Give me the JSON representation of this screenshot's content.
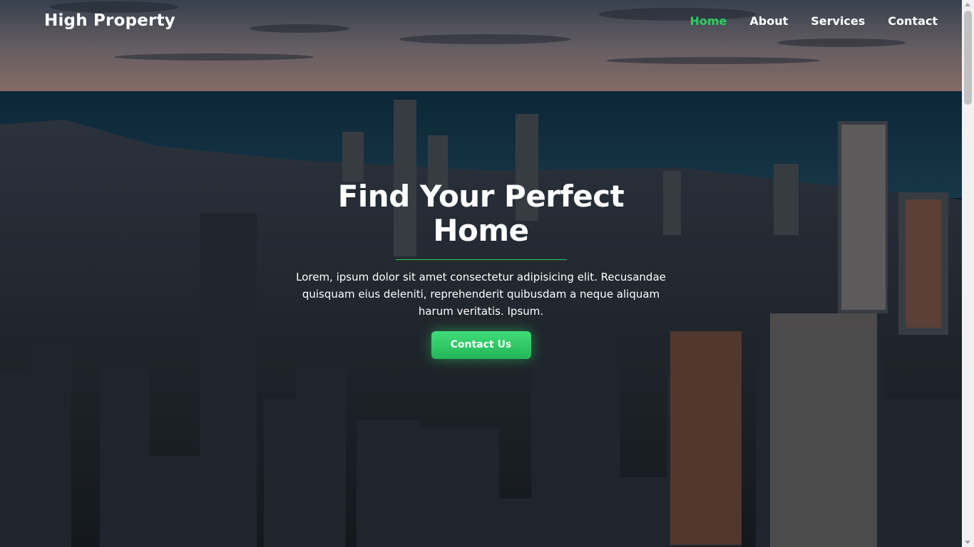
{
  "header": {
    "brand": "High Property",
    "nav": [
      {
        "label": "Home",
        "active": true
      },
      {
        "label": "About",
        "active": false
      },
      {
        "label": "Services",
        "active": false
      },
      {
        "label": "Contact",
        "active": false
      }
    ]
  },
  "hero": {
    "title": "Find Your Perfect Home",
    "description": "Lorem, ipsum dolor sit amet consectetur adipisicing elit. Recusandae quisquam eius deleniti, reprehenderit quibusdam a neque aliquam harum veritatis. Ipsum.",
    "cta_label": "Contact Us",
    "background": "city-skyline-aerial"
  },
  "colors": {
    "accent": "#2ecc63",
    "text": "#ffffff"
  }
}
